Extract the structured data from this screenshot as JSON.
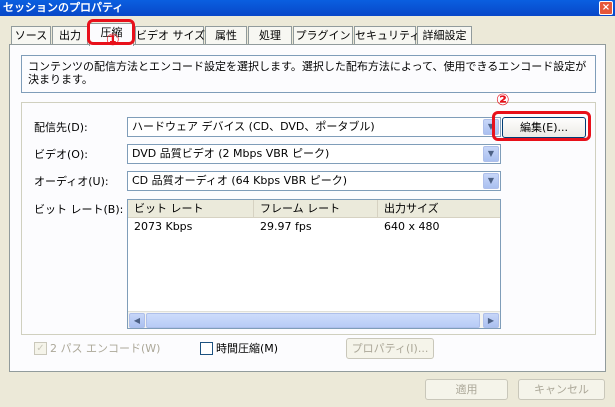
{
  "window": {
    "title": "セッションのプロパティ",
    "close_glyph": "×"
  },
  "tabs": [
    {
      "label": "ソース"
    },
    {
      "label": "出力"
    },
    {
      "label": "圧縮"
    },
    {
      "label": "ビデオ サイズ"
    },
    {
      "label": "属性"
    },
    {
      "label": "処理"
    },
    {
      "label": "プラグイン"
    },
    {
      "label": "セキュリティ"
    },
    {
      "label": "詳細設定"
    }
  ],
  "description": "コンテンツの配信方法とエンコード設定を選択します。選択した配布方法によって、使用できるエンコード設定が決まります。",
  "fields": {
    "distribution": {
      "label": "配信先(D):",
      "value": "ハードウェア デバイス (CD、DVD、ポータブル)"
    },
    "video": {
      "label": "ビデオ(O):",
      "value": "DVD 品質ビデオ (2 Mbps VBR ピーク)"
    },
    "audio": {
      "label": "オーディオ(U):",
      "value": "CD 品質オーディオ (64 Kbps VBR ピーク)"
    },
    "bitrate": {
      "label": "ビット レート(B):"
    }
  },
  "edit_button": "編集(E)...",
  "bitrate_table": {
    "columns": [
      "ビット レート",
      "フレーム レート",
      "出力サイズ"
    ],
    "rows": [
      [
        "2073 Kbps",
        "29.97 fps",
        "640 x 480"
      ]
    ]
  },
  "options": {
    "two_pass": {
      "label": "2 パス エンコード(W)",
      "checked": true,
      "enabled": false
    },
    "time_compression": {
      "label": "時間圧縮(M)",
      "checked": false,
      "enabled": true
    },
    "properties_button": "プロパティ(I)..."
  },
  "footer": {
    "apply": "適用",
    "cancel": "キャンセル"
  },
  "annotations": {
    "one": "①",
    "two": "②",
    "color": "#e8101a"
  },
  "glyphs": {
    "combo_arrow": "▼",
    "scroll_left": "◀",
    "scroll_right": "▶",
    "checkmark": "✓"
  }
}
